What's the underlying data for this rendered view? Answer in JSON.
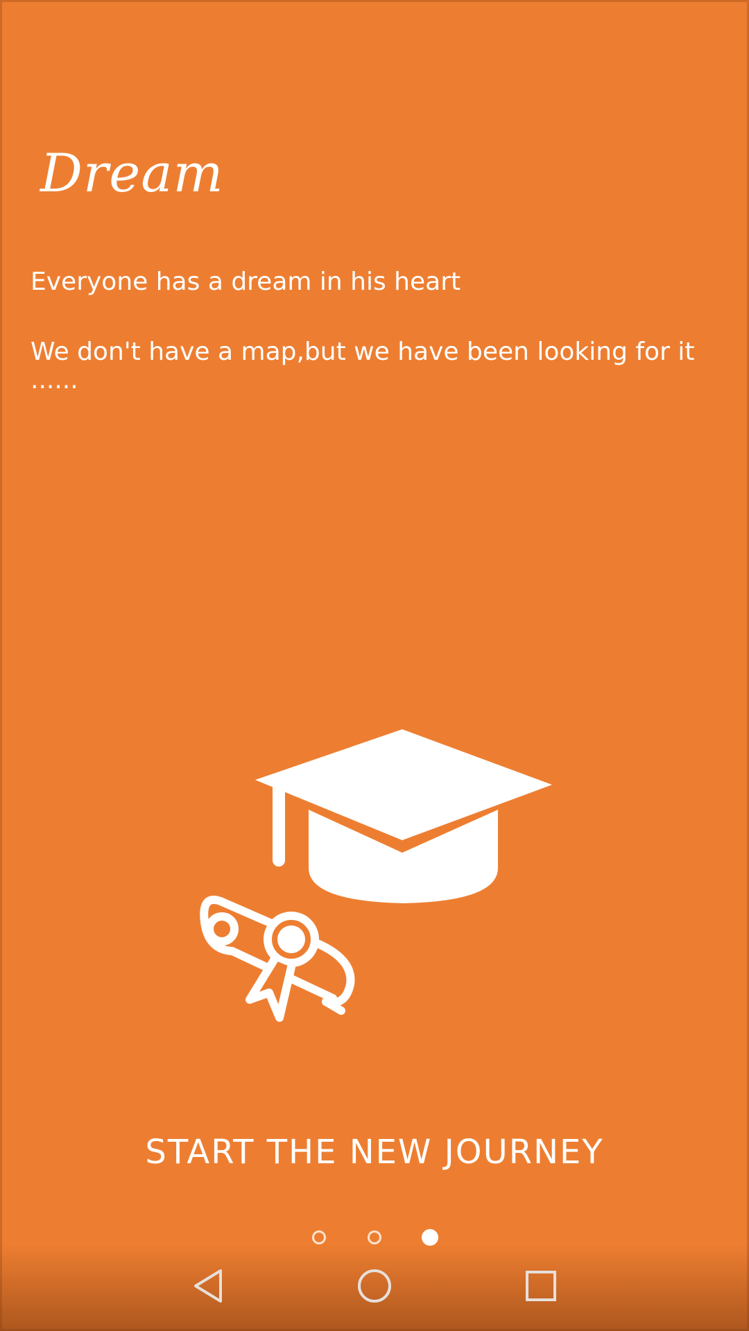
{
  "onboarding": {
    "title": "Dream",
    "line1": "Everyone has a dream in his heart",
    "line2": "We don't have a map,but we have been looking for it ......",
    "cta_label": "START THE NEW JOURNEY",
    "illustration_icons": [
      "graduation-cap-icon",
      "diploma-scroll-icon"
    ]
  },
  "pager": {
    "total": 3,
    "active_index": 2
  },
  "navigation": {
    "buttons": [
      "back-icon",
      "home-icon",
      "recents-icon"
    ]
  },
  "colors": {
    "background": "#ed7e31",
    "foreground": "#ffffff"
  }
}
